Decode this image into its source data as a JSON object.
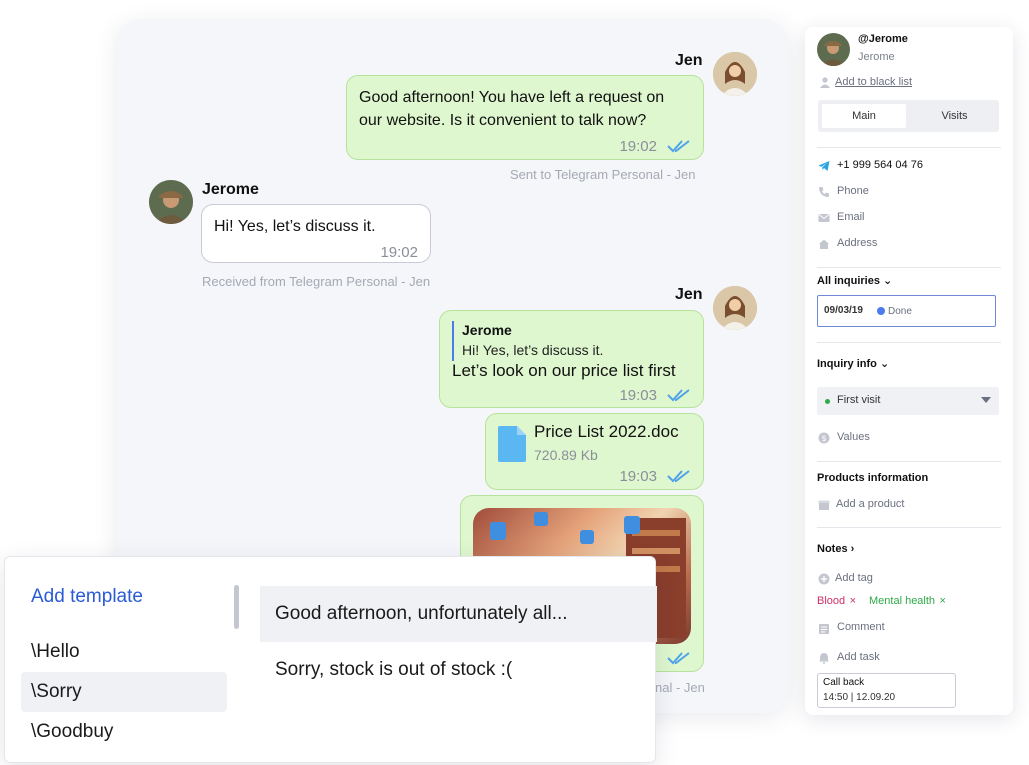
{
  "chat": {
    "messages": [
      {
        "sender": "Jen",
        "text": "Good afternoon! You have left a request on our website. Is it convenient to talk now?",
        "time": "19:02",
        "meta": "Sent to Telegram Personal - Jen"
      },
      {
        "sender": "Jerome",
        "text": "Hi! Yes, let’s discuss it.",
        "time": "19:02",
        "meta": "Received from Telegram Personal - Jen"
      },
      {
        "sender": "Jen",
        "reply_name": "Jerome",
        "reply_text": "Hi! Yes, let’s discuss it.",
        "text": "Let’s look on our price list first",
        "time": "19:03"
      },
      {
        "file_name": "Price List 2022.doc",
        "file_size": "720.89 Kb",
        "time": "19:03"
      },
      {
        "type": "image",
        "meta_partial": "nal - Jen"
      }
    ]
  },
  "templates": {
    "add_label": "Add template",
    "items": [
      "\\Hello",
      "\\Sorry",
      "\\Goodbuy"
    ],
    "active_index": 1,
    "previews": [
      "Good afternoon, unfortunately all...",
      "Sorry, stock is out of stock :("
    ]
  },
  "client": {
    "handle": "@Jerome",
    "name": "Jerome",
    "blacklist_label": "Add to black list",
    "tabs": [
      "Main",
      "Visits"
    ],
    "phone_number": "+1 999 564 04 76",
    "phone_label": "Phone",
    "email_label": "Email",
    "address_label": "Address",
    "all_inquiries_label": "All inquiries",
    "inquiry_date": "09/03/19",
    "inquiry_status": "Done",
    "inquiry_info_label": "Inquiry info",
    "first_visit_label": "First visit",
    "values_label": "Values",
    "products_title": "Products information",
    "add_product_label": "Add a product",
    "notes_label": "Notes",
    "add_tag_label": "Add tag",
    "tags": [
      "Blood",
      "Mental health"
    ],
    "comment_label": "Comment",
    "add_task_label": "Add task",
    "callback_title": "Call back",
    "callback_time": "14:50 | 12.09.20"
  },
  "colors": {
    "out_bubble": "#dff7cf",
    "link_blue": "#2a5bd7",
    "tick_blue": "#4fa3e8",
    "tag_blood": "#d0306a",
    "tag_mental": "#2fa94a"
  }
}
